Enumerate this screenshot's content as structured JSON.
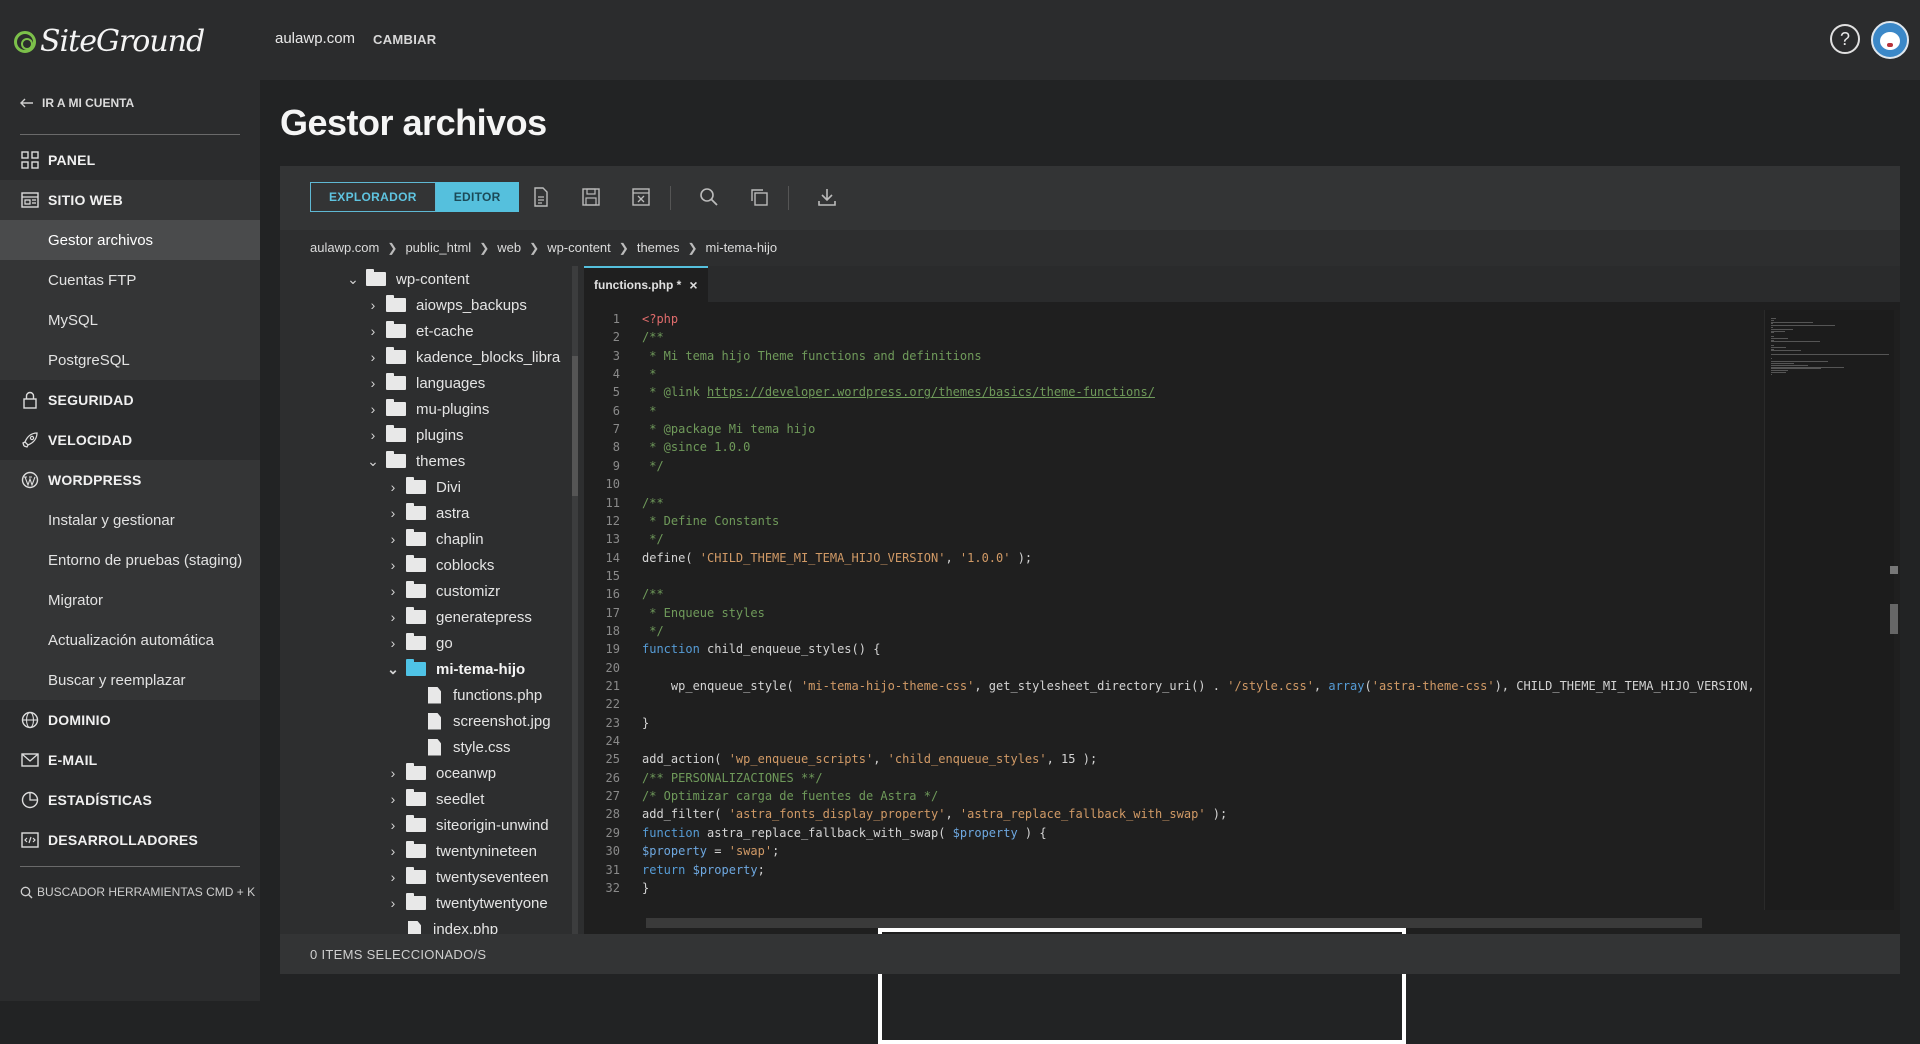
{
  "brand": {
    "name": "SiteGround"
  },
  "header": {
    "site_domain": "aulawp.com",
    "change_label": "CAMBIAR",
    "help_symbol": "?"
  },
  "sidebar": {
    "back_label": "IR A MI CUENTA",
    "items": [
      {
        "label": "PANEL",
        "icon": "grid-icon"
      },
      {
        "label": "SITIO WEB",
        "icon": "website-icon"
      },
      {
        "label": "SEGURIDAD",
        "icon": "lock-icon"
      },
      {
        "label": "VELOCIDAD",
        "icon": "rocket-icon"
      },
      {
        "label": "WORDPRESS",
        "icon": "wordpress-icon"
      },
      {
        "label": "DOMINIO",
        "icon": "globe-icon"
      },
      {
        "label": "E-MAIL",
        "icon": "mail-icon"
      },
      {
        "label": "ESTADÍSTICAS",
        "icon": "stats-icon"
      },
      {
        "label": "DESARROLLADORES",
        "icon": "code-icon"
      }
    ],
    "website_sub": [
      "Gestor archivos",
      "Cuentas FTP",
      "MySQL",
      "PostgreSQL"
    ],
    "wordpress_sub": [
      "Instalar y gestionar",
      "Entorno de pruebas (staging)",
      "Migrator",
      "Actualización automática",
      "Buscar y reemplazar"
    ],
    "search_tools_label": "BUSCADOR HERRAMIENTAS CMD + K"
  },
  "page": {
    "title": "Gestor archivos"
  },
  "toolbar": {
    "explorer_label": "EXPLORADOR",
    "editor_label": "EDITOR"
  },
  "breadcrumb": [
    "aulawp.com",
    "public_html",
    "web",
    "wp-content",
    "themes",
    "mi-tema-hijo"
  ],
  "tree": [
    {
      "name": "wp-content",
      "type": "folder",
      "level": 0,
      "expanded": true
    },
    {
      "name": "aiowps_backups",
      "type": "folder",
      "level": 1
    },
    {
      "name": "et-cache",
      "type": "folder",
      "level": 1
    },
    {
      "name": "kadence_blocks_libra",
      "type": "folder",
      "level": 1
    },
    {
      "name": "languages",
      "type": "folder",
      "level": 1
    },
    {
      "name": "mu-plugins",
      "type": "folder",
      "level": 1
    },
    {
      "name": "plugins",
      "type": "folder",
      "level": 1
    },
    {
      "name": "themes",
      "type": "folder",
      "level": 1,
      "expanded": true
    },
    {
      "name": "Divi",
      "type": "folder",
      "level": 2
    },
    {
      "name": "astra",
      "type": "folder",
      "level": 2
    },
    {
      "name": "chaplin",
      "type": "folder",
      "level": 2
    },
    {
      "name": "coblocks",
      "type": "folder",
      "level": 2
    },
    {
      "name": "customizr",
      "type": "folder",
      "level": 2
    },
    {
      "name": "generatepress",
      "type": "folder",
      "level": 2
    },
    {
      "name": "go",
      "type": "folder",
      "level": 2
    },
    {
      "name": "mi-tema-hijo",
      "type": "folder",
      "level": 2,
      "expanded": true,
      "selected": true
    },
    {
      "name": "functions.php",
      "type": "file",
      "level": 3
    },
    {
      "name": "screenshot.jpg",
      "type": "file",
      "level": 3
    },
    {
      "name": "style.css",
      "type": "file",
      "level": 3
    },
    {
      "name": "oceanwp",
      "type": "folder",
      "level": 2
    },
    {
      "name": "seedlet",
      "type": "folder",
      "level": 2
    },
    {
      "name": "siteorigin-unwind",
      "type": "folder",
      "level": 2
    },
    {
      "name": "twentynineteen",
      "type": "folder",
      "level": 2
    },
    {
      "name": "twentyseventeen",
      "type": "folder",
      "level": 2
    },
    {
      "name": "twentytwentyone",
      "type": "folder",
      "level": 2
    },
    {
      "name": "index.php",
      "type": "file",
      "level": 2
    }
  ],
  "editor": {
    "tab_label": "functions.php *",
    "tab_close": "×",
    "lines": [
      [
        [
          "tag",
          "<?php"
        ]
      ],
      [
        [
          "com",
          "/**"
        ]
      ],
      [
        [
          "com",
          " * Mi tema hijo Theme functions and definitions"
        ]
      ],
      [
        [
          "com",
          " *"
        ]
      ],
      [
        [
          "com",
          " * @link "
        ],
        [
          "link",
          "https://developer.wordpress.org/themes/basics/theme-functions/"
        ]
      ],
      [
        [
          "com",
          " *"
        ]
      ],
      [
        [
          "com",
          " * @package Mi tema hijo"
        ]
      ],
      [
        [
          "com",
          " * @since 1.0.0"
        ]
      ],
      [
        [
          "com",
          " */"
        ]
      ],
      [],
      [
        [
          "com",
          "/**"
        ]
      ],
      [
        [
          "com",
          " * Define Constants"
        ]
      ],
      [
        [
          "com",
          " */"
        ]
      ],
      [
        [
          "pl",
          "define( "
        ],
        [
          "str",
          "'CHILD_THEME_MI_TEMA_HIJO_VERSION'"
        ],
        [
          "pl",
          ", "
        ],
        [
          "str",
          "'1.0.0'"
        ],
        [
          "pl",
          " );"
        ]
      ],
      [],
      [
        [
          "com",
          "/**"
        ]
      ],
      [
        [
          "com",
          " * Enqueue styles"
        ]
      ],
      [
        [
          "com",
          " */"
        ]
      ],
      [
        [
          "kw",
          "function"
        ],
        [
          "pl",
          " child_enqueue_styles() {"
        ]
      ],
      [],
      [
        [
          "pl",
          "    wp_enqueue_style( "
        ],
        [
          "str",
          "'mi-tema-hijo-theme-css'"
        ],
        [
          "pl",
          ", get_stylesheet_directory_uri() . "
        ],
        [
          "str",
          "'/style.css'"
        ],
        [
          "pl",
          ", "
        ],
        [
          "kw",
          "array"
        ],
        [
          "pl",
          "("
        ],
        [
          "str",
          "'astra-theme-css'"
        ],
        [
          "pl",
          "), CHILD_THEME_MI_TEMA_HIJO_VERSION,"
        ]
      ],
      [],
      [
        [
          "pl",
          "}"
        ]
      ],
      [],
      [
        [
          "pl",
          "add_action( "
        ],
        [
          "str",
          "'wp_enqueue_scripts'"
        ],
        [
          "pl",
          ", "
        ],
        [
          "str",
          "'child_enqueue_styles'"
        ],
        [
          "pl",
          ", 15 );"
        ]
      ],
      [
        [
          "com",
          "/** PERSONALIZACIONES **/"
        ]
      ],
      [
        [
          "com",
          "/* Optimizar carga de fuentes de Astra */"
        ]
      ],
      [
        [
          "pl",
          "add_filter( "
        ],
        [
          "str",
          "'astra_fonts_display_property'"
        ],
        [
          "pl",
          ", "
        ],
        [
          "str",
          "'astra_replace_fallback_with_swap'"
        ],
        [
          "pl",
          " );"
        ]
      ],
      [
        [
          "kw",
          "function"
        ],
        [
          "pl",
          " astra_replace_fallback_with_swap( "
        ],
        [
          "var",
          "$property"
        ],
        [
          "pl",
          " ) {"
        ]
      ],
      [
        [
          "var",
          "$property"
        ],
        [
          "pl",
          " = "
        ],
        [
          "str",
          "'swap'"
        ],
        [
          "pl",
          ";"
        ]
      ],
      [
        [
          "kw",
          "return"
        ],
        [
          "pl",
          " "
        ],
        [
          "var",
          "$property"
        ],
        [
          "pl",
          ";"
        ]
      ],
      [
        [
          "pl",
          "}"
        ]
      ]
    ]
  },
  "status": {
    "selected_text": "0 ITEMS SELECCIONADO/S"
  }
}
